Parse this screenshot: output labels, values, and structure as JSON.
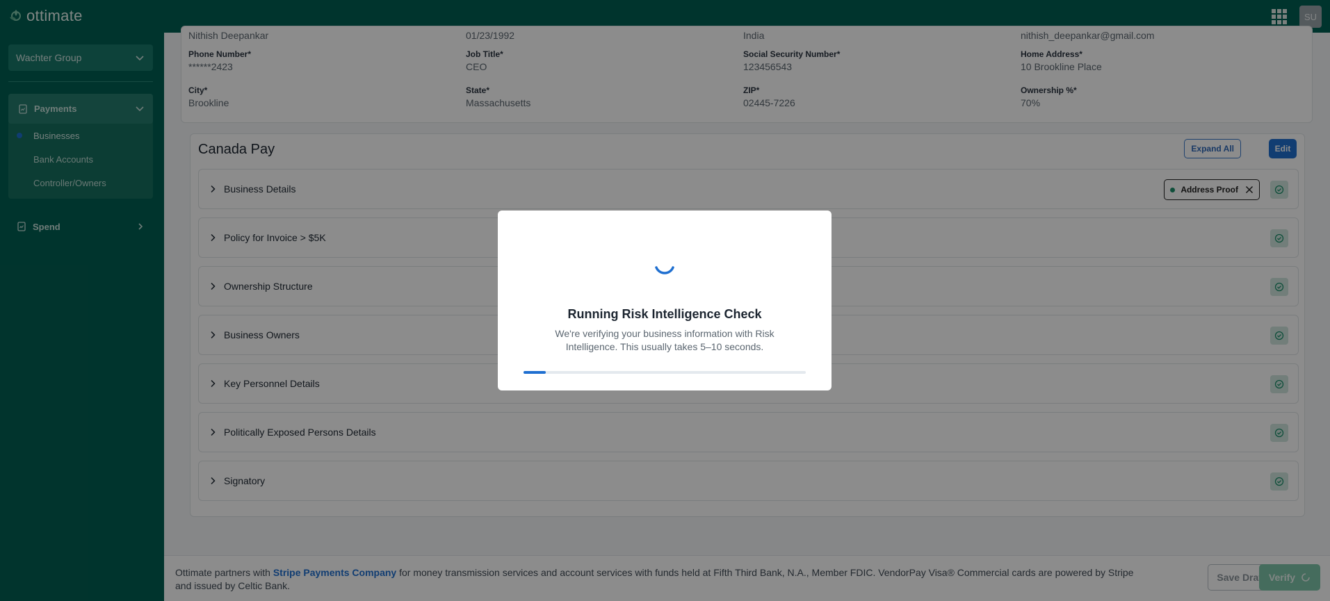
{
  "app": {
    "name": "ottimate",
    "avatar_initials": "SU"
  },
  "sidebar": {
    "org": "Wachter Group",
    "payments_label": "Payments",
    "items": [
      {
        "label": "Businesses",
        "active": true
      },
      {
        "label": "Bank Accounts",
        "active": false
      },
      {
        "label": "Controller/Owners",
        "active": false
      }
    ],
    "spend_label": "Spend"
  },
  "owner": {
    "name": "Nithish Deepankar",
    "dob": "01/23/1992",
    "country": "India",
    "email": "nithish_deepankar@gmail.com",
    "fields": [
      {
        "label": "Phone Number*",
        "value": "******2423"
      },
      {
        "label": "Job Title*",
        "value": "CEO"
      },
      {
        "label": "Social Security Number*",
        "value": "123456543"
      },
      {
        "label": "Home Address*",
        "value": "10 Brookline Place"
      },
      {
        "label": "City*",
        "value": "Brookline"
      },
      {
        "label": "State*",
        "value": "Massachusetts"
      },
      {
        "label": "ZIP*",
        "value": "02445-7226"
      },
      {
        "label": "Ownership %*",
        "value": "70%"
      }
    ]
  },
  "card": {
    "title": "Canada Pay",
    "expand_all": "Expand All",
    "edit": "Edit",
    "sections": [
      {
        "label": "Business Details",
        "tag": "Address Proof"
      },
      {
        "label": "Policy for Invoice > $5K"
      },
      {
        "label": "Ownership Structure"
      },
      {
        "label": "Business Owners"
      },
      {
        "label": "Key Personnel Details"
      },
      {
        "label": "Politically Exposed Persons Details"
      },
      {
        "label": "Signatory"
      }
    ]
  },
  "footer": {
    "text_before": "Ottimate partners with ",
    "link": "Stripe Payments Company",
    "text_after": " for money transmission services and account services with funds held at Fifth Third Bank, N.A., Member FDIC. VendorPay Visa® Commercial cards are powered by Stripe and issued by Celtic Bank.",
    "save_draft": "Save Draft",
    "verify": "Verify"
  },
  "modal": {
    "title": "Running Risk Intelligence Check",
    "description": "We're verifying your business information with Risk Intelligence. This usually takes 5–10 seconds.",
    "progress": 0.08
  },
  "colors": {
    "brand": "#015f52",
    "accent": "#1f6fd0"
  }
}
